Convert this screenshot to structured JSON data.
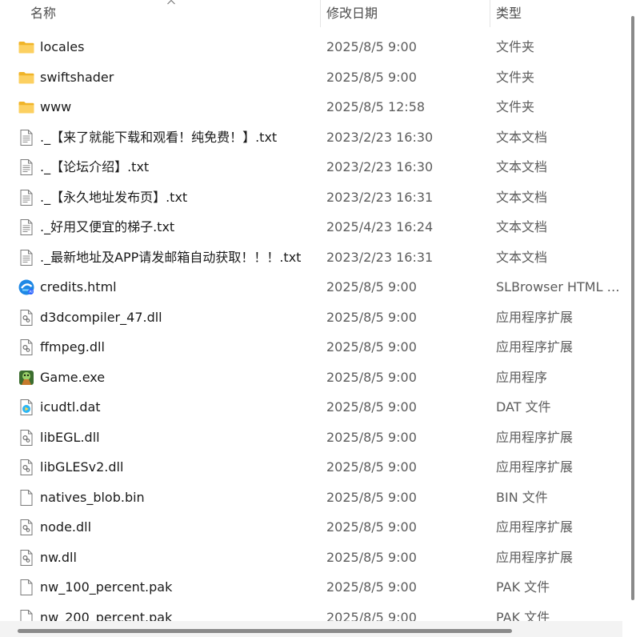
{
  "columns": {
    "name": "名称",
    "date": "修改日期",
    "type": "类型"
  },
  "colors": {
    "folder": "#f5c04a",
    "text": "#1a1a1a",
    "muted": "#5c5c5c",
    "scrollbar": "#8a8a8a"
  },
  "files": [
    {
      "icon": "folder-icon",
      "name": "locales",
      "date": "2025/8/5 9:00",
      "type": "文件夹"
    },
    {
      "icon": "folder-icon",
      "name": "swiftshader",
      "date": "2025/8/5 9:00",
      "type": "文件夹"
    },
    {
      "icon": "folder-icon",
      "name": "www",
      "date": "2025/8/5 12:58",
      "type": "文件夹"
    },
    {
      "icon": "text-file-icon",
      "name": "._【来了就能下载和观看！纯免费！】.txt",
      "date": "2023/2/23 16:30",
      "type": "文本文档"
    },
    {
      "icon": "text-file-icon",
      "name": "._【论坛介绍】.txt",
      "date": "2023/2/23 16:30",
      "type": "文本文档"
    },
    {
      "icon": "text-file-icon",
      "name": "._【永久地址发布页】.txt",
      "date": "2023/2/23 16:31",
      "type": "文本文档"
    },
    {
      "icon": "text-file-icon",
      "name": "._好用又便宜的梯子.txt",
      "date": "2025/4/23 16:24",
      "type": "文本文档"
    },
    {
      "icon": "text-file-icon",
      "name": "._最新地址及APP请发邮箱自动获取！！！.txt",
      "date": "2023/2/23 16:31",
      "type": "文本文档"
    },
    {
      "icon": "browser-html-icon",
      "name": "credits.html",
      "date": "2025/8/5 9:00",
      "type": "SLBrowser HTML D..."
    },
    {
      "icon": "dll-file-icon",
      "name": "d3dcompiler_47.dll",
      "date": "2025/8/5 9:00",
      "type": "应用程序扩展"
    },
    {
      "icon": "dll-file-icon",
      "name": "ffmpeg.dll",
      "date": "2025/8/5 9:00",
      "type": "应用程序扩展"
    },
    {
      "icon": "game-exe-icon",
      "name": "Game.exe",
      "date": "2025/8/5 9:00",
      "type": "应用程序"
    },
    {
      "icon": "media-file-icon",
      "name": "icudtl.dat",
      "date": "2025/8/5 9:00",
      "type": "DAT 文件"
    },
    {
      "icon": "dll-file-icon",
      "name": "libEGL.dll",
      "date": "2025/8/5 9:00",
      "type": "应用程序扩展"
    },
    {
      "icon": "dll-file-icon",
      "name": "libGLESv2.dll",
      "date": "2025/8/5 9:00",
      "type": "应用程序扩展"
    },
    {
      "icon": "blank-file-icon",
      "name": "natives_blob.bin",
      "date": "2025/8/5 9:00",
      "type": "BIN 文件"
    },
    {
      "icon": "dll-file-icon",
      "name": "node.dll",
      "date": "2025/8/5 9:00",
      "type": "应用程序扩展"
    },
    {
      "icon": "dll-file-icon",
      "name": "nw.dll",
      "date": "2025/8/5 9:00",
      "type": "应用程序扩展"
    },
    {
      "icon": "blank-file-icon",
      "name": "nw_100_percent.pak",
      "date": "2025/8/5 9:00",
      "type": "PAK 文件"
    },
    {
      "icon": "blank-file-icon",
      "name": "nw_200_percent.pak",
      "date": "2025/8/5 9:00",
      "type": "PAK 文件"
    }
  ]
}
